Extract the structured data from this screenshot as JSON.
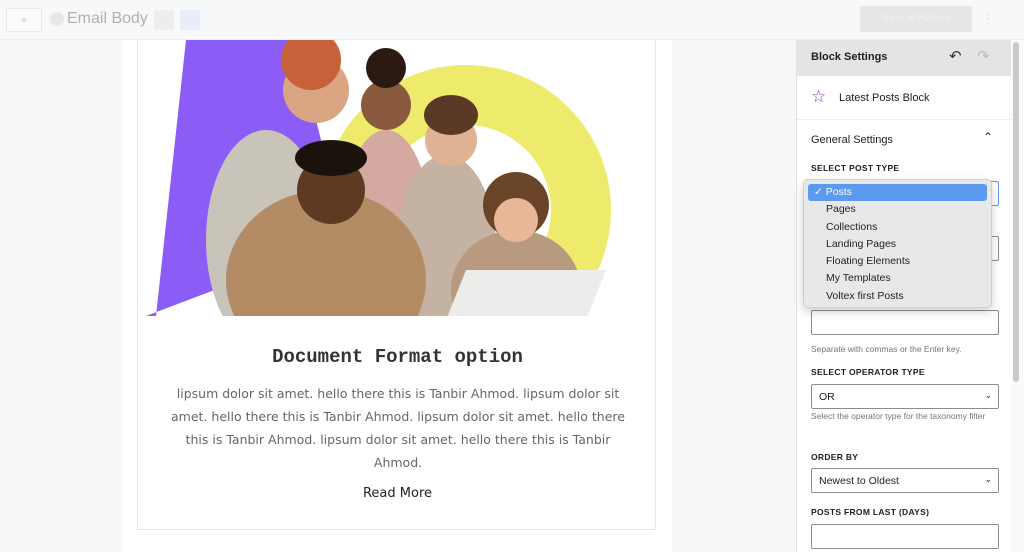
{
  "topbar": {
    "add_label": "+",
    "title": "Email Body",
    "publish_label": "Save & Publish",
    "more": "⋮"
  },
  "email": {
    "title": "Document Format option",
    "body": "lipsum dolor sit amet. hello there this is Tanbir Ahmod. lipsum dolor sit amet. hello there this is Tanbir Ahmod. lipsum dolor sit amet. hello there this is Tanbir Ahmod. lipsum dolor sit amet. hello there this is Tanbir Ahmod.",
    "read_more": "Read More",
    "colors": {
      "purple": "#8b5cf6",
      "yellow": "#eeea6c"
    }
  },
  "panel": {
    "header": "Block Settings",
    "undo_icon": "undo-icon",
    "redo_icon": "redo-icon",
    "block_name": "Latest Posts Block",
    "block_icon": "star-icon",
    "section": "General Settings",
    "post_type_label": "SELECT POST TYPE",
    "post_type_options": [
      "Posts",
      "Pages",
      "Collections",
      "Landing Pages",
      "Floating Elements",
      "My Templates",
      "Voltex first Posts"
    ],
    "post_type_selected": "Posts",
    "tags_help": "Separate with commas or the Enter key.",
    "operator_label": "SELECT OPERATOR TYPE",
    "operator_value": "OR",
    "operator_help": "Select the operator type for the taxonomy filter",
    "order_label": "ORDER BY",
    "order_value": "Newest to Oldest",
    "days_label": "POSTS FROM LAST (DAYS)",
    "accent": "#5b9aee"
  }
}
